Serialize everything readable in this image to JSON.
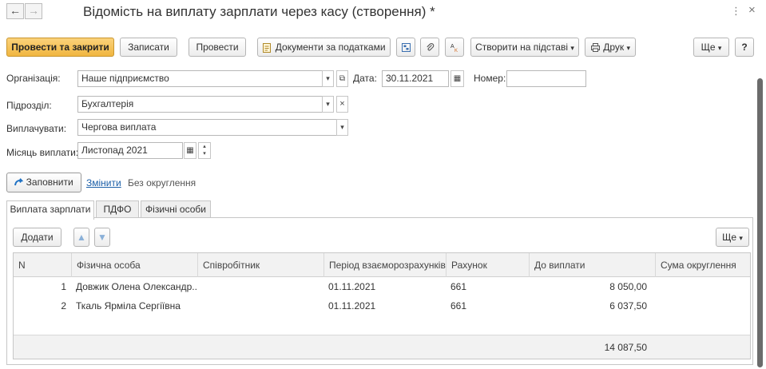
{
  "window": {
    "title": "Відомість на виплату зарплати через касу (створення) *",
    "back_icon": "←",
    "forward_icon": "→",
    "more_icon": "⋮",
    "close_icon": "×"
  },
  "toolbar": {
    "post_close": "Провести та закрити",
    "save": "Записати",
    "post": "Провести",
    "tax_docs": "Документи за податками",
    "create_based": "Створити на підставі",
    "print": "Друк",
    "more": "Ще",
    "help": "?",
    "dropdown_glyph": "▾"
  },
  "form": {
    "org_label": "Організація:",
    "org_value": "Наше підприємство",
    "date_label": "Дата:",
    "date_value": "30.11.2021",
    "number_label": "Номер:",
    "number_value": "",
    "dept_label": "Підрозділ:",
    "dept_value": "Бухгалтерія",
    "pay_label": "Виплачувати:",
    "pay_value": "Чергова виплата",
    "month_label": "Місяць виплати:",
    "month_value": "Листопад 2021"
  },
  "actions": {
    "fill": "Заповнити",
    "change": "Змінити",
    "rounding": "Без округлення"
  },
  "tabs": [
    {
      "label": "Виплата зарплати",
      "active": true
    },
    {
      "label": "ПДФО",
      "active": false
    },
    {
      "label": "Фізичні особи",
      "active": false
    }
  ],
  "table_toolbar": {
    "add": "Додати",
    "more": "Ще"
  },
  "table": {
    "columns": [
      "N",
      "Фізична особа",
      "Співробітник",
      "Період взаєморозрахунків",
      "Рахунок",
      "До виплати",
      "Сума округлення"
    ],
    "rows": [
      {
        "n": "1",
        "person": "Довжик Олена Олександр...",
        "employee": "",
        "period": "01.11.2021",
        "account": "661",
        "amount": "8 050,00",
        "rounding": ""
      },
      {
        "n": "2",
        "person": "Ткаль Ярміла Сергіївна",
        "employee": "",
        "period": "01.11.2021",
        "account": "661",
        "amount": "6 037,50",
        "rounding": ""
      }
    ],
    "total": "14 087,50"
  },
  "colors": {
    "primary_button": "#f0b640",
    "link": "#1b5fa8",
    "fill_icon": "#1f72c4"
  }
}
